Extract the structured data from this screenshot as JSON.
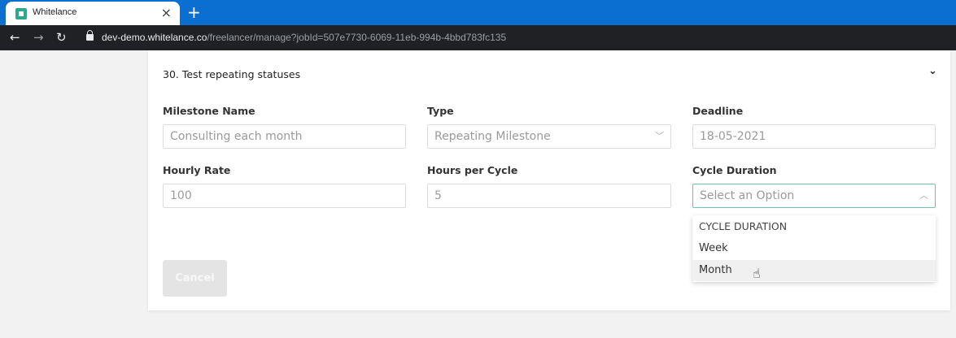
{
  "browser": {
    "tab_title": "Whitelance",
    "url_domain": "dev-demo.whitelance.co",
    "url_path": "/freelancer/manage?jobId=507e7730-6069-11eb-994b-4bbd783fc135"
  },
  "milestone": {
    "title": "30. Test repeating statuses",
    "name_label": "Milestone Name",
    "name_value": "Consulting each month",
    "type_label": "Type",
    "type_value": "Repeating Milestone",
    "deadline_label": "Deadline",
    "deadline_value": "18-05-2021",
    "rate_label": "Hourly Rate",
    "rate_value": "100",
    "hours_label": "Hours per Cycle",
    "hours_value": "5",
    "cycle_label": "Cycle Duration",
    "cycle_placeholder": "Select an Option",
    "cycle_options": [
      "CYCLE DURATION",
      "Week",
      "Month"
    ],
    "cancel_label": "Cancel"
  },
  "colors": {
    "tabbar": "#0a6fd1",
    "urlbar": "#202124",
    "focus_border": "#6cc3a8"
  }
}
